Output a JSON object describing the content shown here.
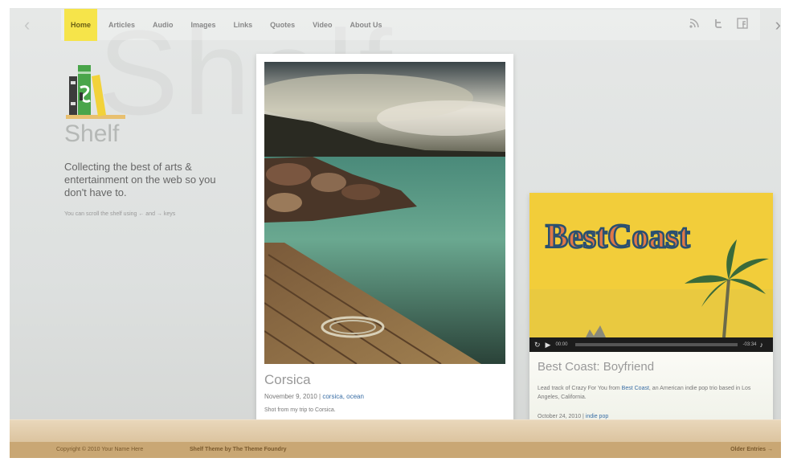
{
  "nav": {
    "items": [
      {
        "label": "Home",
        "active": true
      },
      {
        "label": "Articles",
        "active": false
      },
      {
        "label": "Audio",
        "active": false
      },
      {
        "label": "Images",
        "active": false
      },
      {
        "label": "Links",
        "active": false
      },
      {
        "label": "Quotes",
        "active": false
      },
      {
        "label": "Video",
        "active": false
      },
      {
        "label": "About Us",
        "active": false
      }
    ],
    "icons": [
      "rss-icon",
      "twitter-icon",
      "facebook-icon"
    ],
    "accent": "#f6e44a"
  },
  "watermark": "Shelf",
  "sidebar": {
    "title": "Shelf",
    "tagline": "Collecting the best of arts & entertainment on the web so you don't have to.",
    "hint": "You can scroll the shelf using ← and → keys"
  },
  "post1": {
    "title": "Corsica",
    "date": "November 9, 2010",
    "tags": "corsica, ocean",
    "description": "Shot from my trip to Corsica."
  },
  "post2": {
    "cover_text": "BestCoast",
    "title": "Best Coast: Boyfriend",
    "desc_prefix": "Lead track of Crazy For You from ",
    "desc_link": "Best Coast",
    "desc_suffix": ", an American indie pop trio based in Los Angeles, California.",
    "date": "October 24, 2010",
    "tags": "indie pop",
    "player": {
      "elapsed": "00:00",
      "remaining": "-03:34"
    }
  },
  "footer": {
    "copyright": "Copyright © 2010 Your Name Here",
    "theme": "Shelf Theme by The Theme Foundry",
    "older": "Older Entries →"
  }
}
